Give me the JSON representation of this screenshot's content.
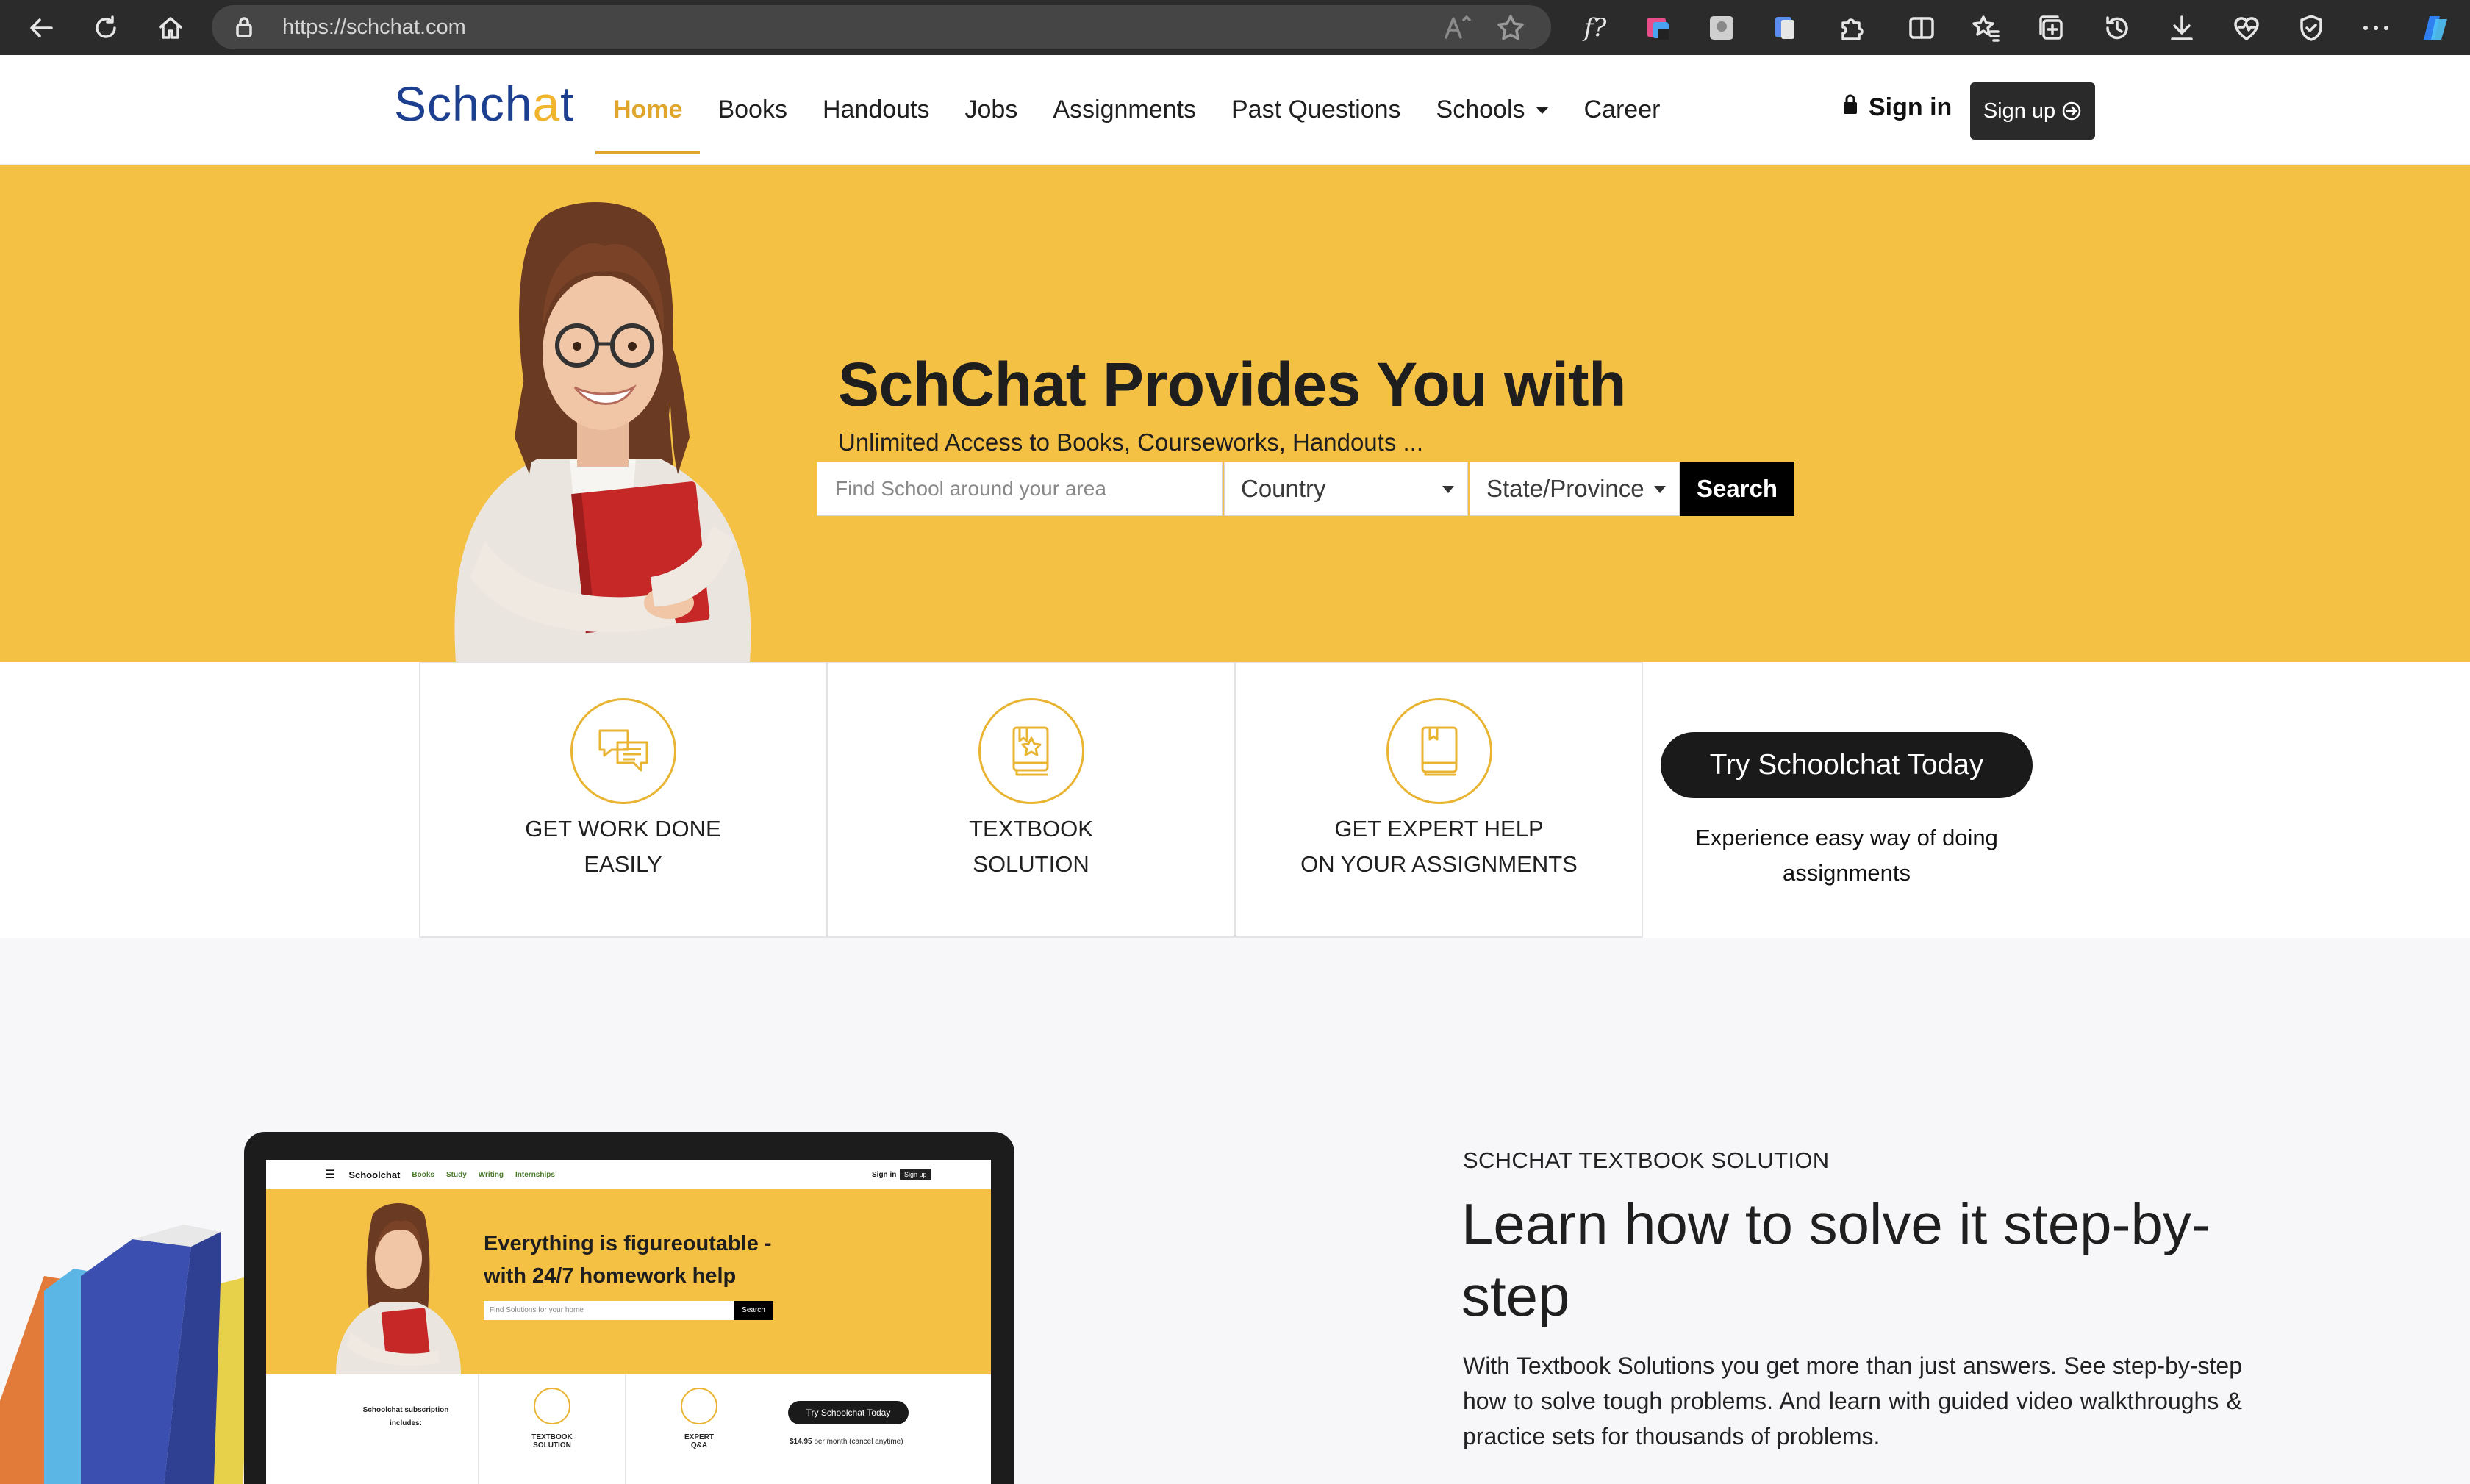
{
  "browser": {
    "url": "https://schchat.com",
    "icons": [
      "back-icon",
      "reload-icon",
      "home-icon",
      "lock-icon",
      "read-aloud-icon",
      "favorite-star-icon",
      "formula-extension-icon",
      "colorpicker-extension-icon",
      "extension-icon",
      "extension-icon",
      "extensions-puzzle-icon",
      "split-screen-icon",
      "favorites-icon",
      "collections-icon",
      "history-icon",
      "downloads-icon",
      "performance-icon",
      "browser-essentials-icon",
      "more-menu-icon",
      "copilot-icon"
    ]
  },
  "header": {
    "logo_text_a": "Schch",
    "logo_text_b": "a",
    "logo_text_c": "t",
    "nav": [
      {
        "label": "Home",
        "active": true
      },
      {
        "label": "Books"
      },
      {
        "label": "Handouts"
      },
      {
        "label": "Jobs"
      },
      {
        "label": "Assignments"
      },
      {
        "label": "Past Questions"
      },
      {
        "label": "Schools",
        "dropdown": true
      },
      {
        "label": "Career"
      }
    ],
    "signin_label": "Sign in",
    "signup_label": "Sign up"
  },
  "hero": {
    "title": "SchChat Provides You with",
    "subtitle": "Unlimited Access to Books, Courseworks, Handouts ...",
    "search_placeholder": "Find School around your area",
    "country_select": "Country",
    "state_select": "State/Province",
    "search_button": "Search"
  },
  "features": {
    "cards": [
      {
        "line1": "GET WORK DONE",
        "line2": "EASILY",
        "icon": "chat-bubbles-icon"
      },
      {
        "line1": "TEXTBOOK",
        "line2": "SOLUTION",
        "icon": "textbook-star-icon"
      },
      {
        "line1": "GET EXPERT HELP",
        "line2": "ON YOUR ASSIGNMENTS",
        "icon": "book-icon"
      }
    ],
    "try_button": "Try Schoolchat Today",
    "try_text": "Experience easy way of doing assignments"
  },
  "laptop_screen": {
    "logo": "Schoolchat",
    "links": [
      "Books",
      "Study",
      "Writing",
      "Internships"
    ],
    "signin": "Sign in",
    "signup": "Sign up",
    "title": "Everything is figureoutable - with 24/7 homework help",
    "search_placeholder": "Find Solutions for your home",
    "search_button": "Search",
    "subscription": "Schoolchat subscription includes:",
    "cells": [
      "TEXTBOOK SOLUTION",
      "EXPERT Q&A"
    ],
    "try_button": "Try Schoolchat Today",
    "price": "$14.95",
    "price_note": "per month (cancel anytime)"
  },
  "lower": {
    "eyebrow": "SCHCHAT TEXTBOOK SOLUTION",
    "title": "Learn how to solve it step-by-step",
    "body": "With Textbook Solutions you get more than just answers. See step-by-step how to solve tough problems. And learn with guided video walkthroughs & practice sets for thousands of problems."
  },
  "colors": {
    "brand_yellow": "#f4c144",
    "accent_gold": "#e0a52b",
    "logo_blue": "#1d3f8f",
    "dark_button": "#1a1a1a"
  }
}
